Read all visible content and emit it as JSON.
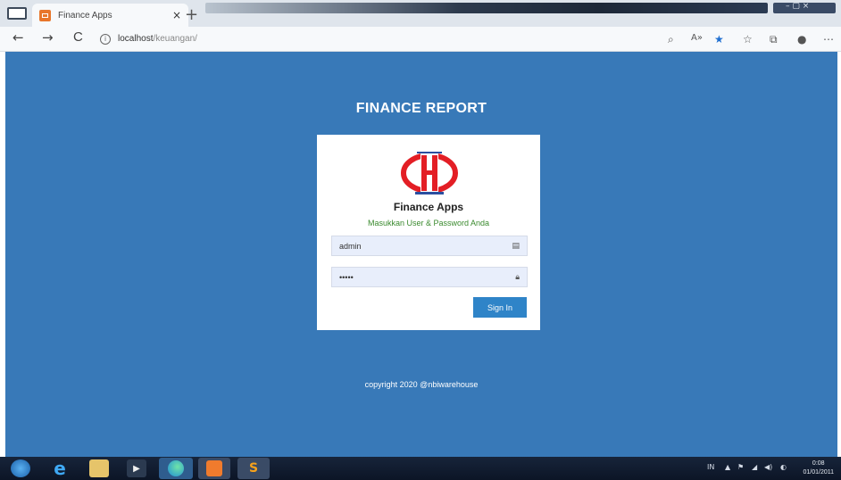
{
  "browser": {
    "tab_title": "Finance Apps",
    "tab_close": "×",
    "new_tab": "+",
    "url_host": "localhost",
    "url_path": "/keuangan/",
    "nav_back": "←",
    "nav_forward": "→",
    "nav_reload": "C",
    "info_icon": "i",
    "window_controls": "–  ▢  ×"
  },
  "page": {
    "title": "FINANCE REPORT",
    "app_name": "Finance Apps",
    "subtitle": "Masukkan User & Password Anda",
    "username_value": "admin",
    "password_value": "•••••",
    "signin_label": "Sign In",
    "copyright": "copyright 2020 @nbiwarehouse"
  },
  "colors": {
    "page_bg": "#3879b8",
    "button": "#2f84c8",
    "logo_red": "#e31e25",
    "subtitle_green": "#3a8a2e"
  },
  "taskbar": {
    "tray_lang": "IN",
    "time": "0:08",
    "date": "01/01/2011",
    "apps": [
      "windows-start-icon",
      "ie-icon",
      "explorer-icon",
      "media-player-icon",
      "edge-icon",
      "xampp-icon",
      "sublime-icon"
    ]
  }
}
